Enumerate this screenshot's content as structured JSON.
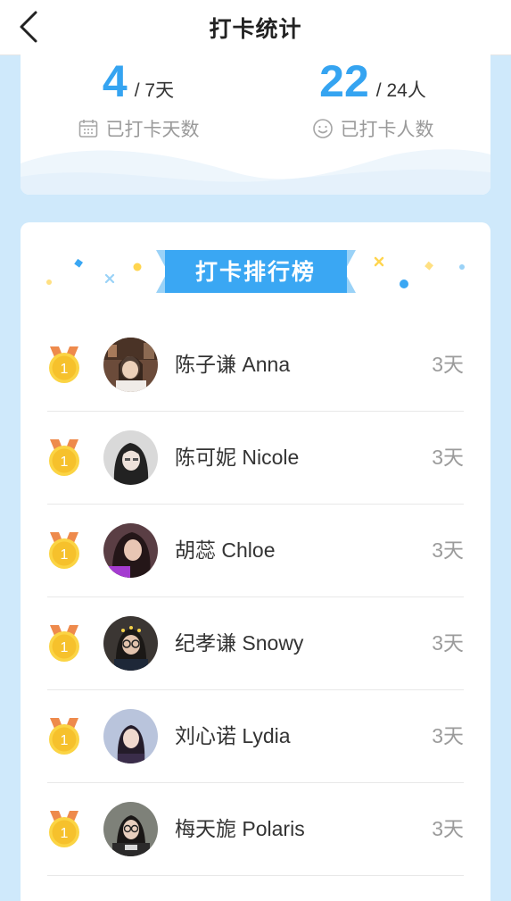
{
  "header": {
    "title": "打卡统计",
    "back_icon": "chevron-left-icon"
  },
  "stats": {
    "checked_days": {
      "value": "4",
      "unit": "/ 7天",
      "label": "已打卡天数",
      "icon": "calendar-icon"
    },
    "checked_people": {
      "value": "22",
      "unit": "/ 24人",
      "label": "已打卡人数",
      "icon": "smiley-icon"
    }
  },
  "leaderboard": {
    "title": "打卡排行榜",
    "rows": [
      {
        "rank": "1",
        "name": "陈子谦 Anna",
        "days": "3天"
      },
      {
        "rank": "1",
        "name": "陈可妮 Nicole",
        "days": "3天"
      },
      {
        "rank": "1",
        "name": "胡蕊 Chloe",
        "days": "3天"
      },
      {
        "rank": "1",
        "name": "纪孝谦 Snowy",
        "days": "3天"
      },
      {
        "rank": "1",
        "name": "刘心诺 Lydia",
        "days": "3天"
      },
      {
        "rank": "1",
        "name": "梅天旎 Polaris",
        "days": "3天"
      }
    ]
  },
  "colors": {
    "accent": "#35a4f1",
    "background": "#cfe9fb",
    "medal": "#f7c430",
    "ribbon": "#ee8a4c"
  }
}
